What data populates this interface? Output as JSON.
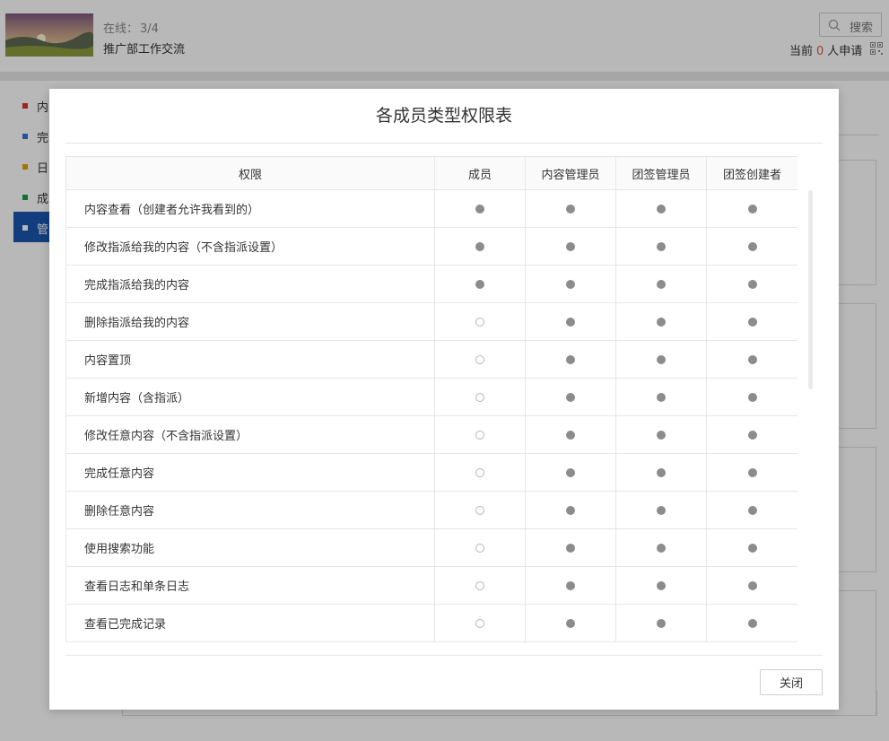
{
  "header": {
    "online_label": "在线：",
    "online_count": "3/4",
    "group_name": "推广部工作交流",
    "search_label": "搜索",
    "apply_prefix": "当前",
    "apply_count": "0",
    "apply_suffix": "人申请"
  },
  "sidebar": {
    "items": [
      {
        "label": "内",
        "color": "#d9322c"
      },
      {
        "label": "完",
        "color": "#3a6fd8"
      },
      {
        "label": "日",
        "color": "#e0a400"
      },
      {
        "label": "成",
        "color": "#1a9c4b"
      },
      {
        "label": "管",
        "color": "#ffffff"
      }
    ],
    "active_index": 4
  },
  "modal": {
    "title": "各成员类型权限表",
    "close_label": "关闭",
    "columns": [
      "权限",
      "成员",
      "内容管理员",
      "团签管理员",
      "团签创建者"
    ],
    "rows": [
      {
        "permission": "内容查看（创建者允许我看到的）",
        "member": "●",
        "content_admin": "●",
        "team_admin": "●",
        "creator": "●"
      },
      {
        "permission": "修改指派给我的内容（不含指派设置）",
        "member": "●",
        "content_admin": "●",
        "team_admin": "●",
        "creator": "●"
      },
      {
        "permission": "完成指派给我的内容",
        "member": "●",
        "content_admin": "●",
        "team_admin": "●",
        "creator": "●"
      },
      {
        "permission": "删除指派给我的内容",
        "member": "○",
        "content_admin": "●",
        "team_admin": "●",
        "creator": "●"
      },
      {
        "permission": "内容置顶",
        "member": "○",
        "content_admin": "●",
        "team_admin": "●",
        "creator": "●"
      },
      {
        "permission": "新增内容（含指派）",
        "member": "○",
        "content_admin": "●",
        "team_admin": "●",
        "creator": "●"
      },
      {
        "permission": "修改任意内容（不含指派设置）",
        "member": "○",
        "content_admin": "●",
        "team_admin": "●",
        "creator": "●"
      },
      {
        "permission": "完成任意内容",
        "member": "○",
        "content_admin": "●",
        "team_admin": "●",
        "creator": "●"
      },
      {
        "permission": "删除任意内容",
        "member": "○",
        "content_admin": "●",
        "team_admin": "●",
        "creator": "●"
      },
      {
        "permission": "使用搜索功能",
        "member": "○",
        "content_admin": "●",
        "team_admin": "●",
        "creator": "●"
      },
      {
        "permission": "查看日志和单条日志",
        "member": "○",
        "content_admin": "●",
        "team_admin": "●",
        "creator": "●"
      },
      {
        "permission": "查看已完成记录",
        "member": "○",
        "content_admin": "●",
        "team_admin": "●",
        "creator": "●"
      }
    ]
  },
  "colors": {
    "accent": "#1a56b0",
    "apply_count": "#d9534f",
    "granted_mark": "#8c8c8c",
    "denied_mark": "#b5b5b5"
  },
  "icons": {
    "search": "search-icon",
    "qr": "qr-code-icon",
    "granted": "filled-circle-icon",
    "denied": "hollow-circle-icon"
  }
}
